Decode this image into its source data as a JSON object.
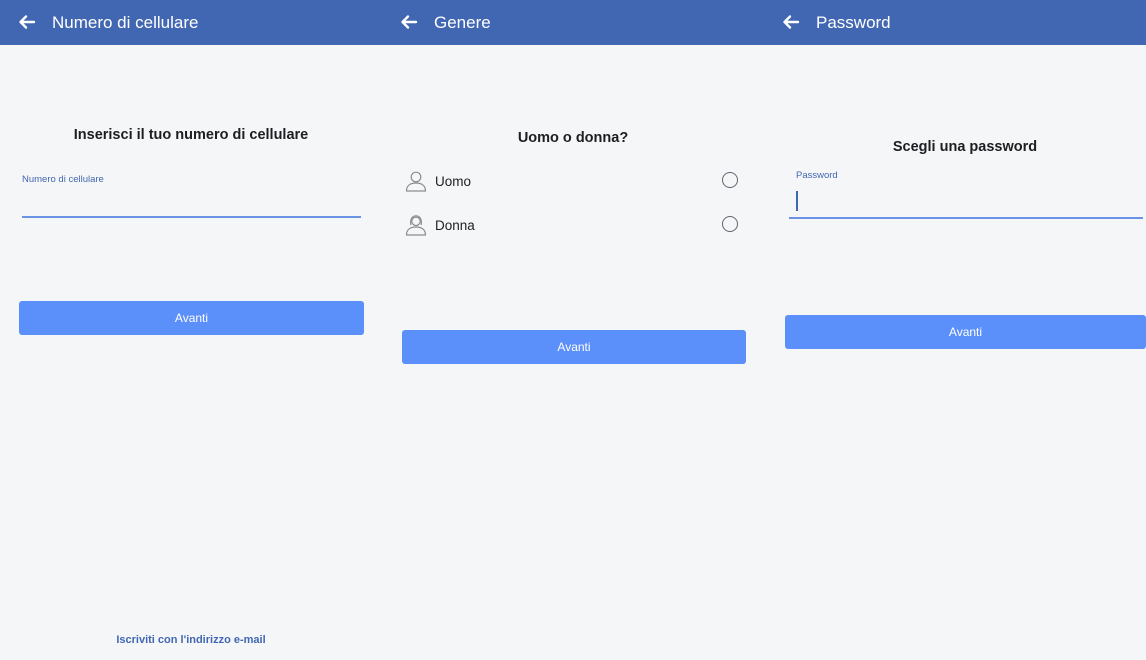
{
  "screens": {
    "phone": {
      "title": "Numero di cellulare",
      "heading": "Inserisci il tuo numero di cellulare",
      "field_label": "Numero di cellulare",
      "field_value": "",
      "next_label": "Avanti",
      "email_link": "Iscriviti con l'indirizzo e-mail"
    },
    "gender": {
      "title": "Genere",
      "heading": "Uomo o donna?",
      "options": [
        {
          "label": "Uomo",
          "icon": "male-user-icon",
          "selected": false
        },
        {
          "label": "Donna",
          "icon": "female-user-icon",
          "selected": false
        }
      ],
      "next_label": "Avanti"
    },
    "password": {
      "title": "Password",
      "heading": "Scegli una password",
      "field_label": "Password",
      "field_value": "",
      "next_label": "Avanti"
    }
  },
  "colors": {
    "header": "#4267b2",
    "button": "#5b8ff9",
    "background": "#f5f6f8",
    "accent": "#4267b2"
  },
  "icons": {
    "back": "arrow-left-icon"
  }
}
